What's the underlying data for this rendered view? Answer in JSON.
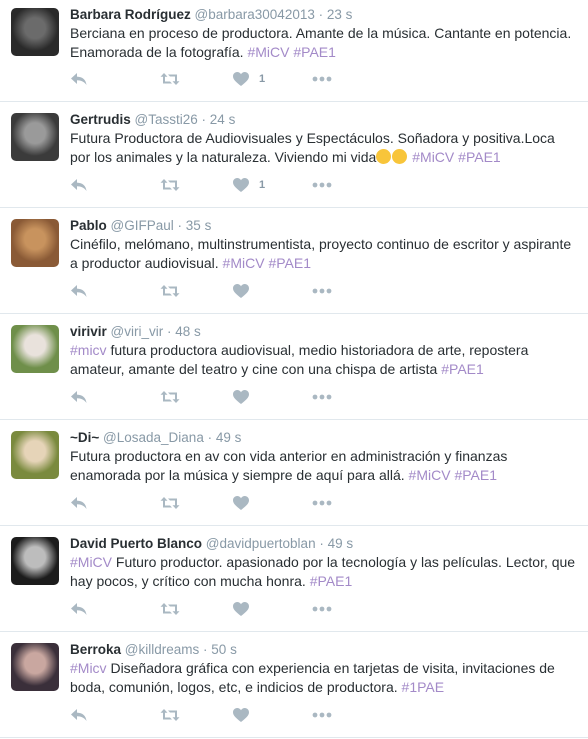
{
  "tweets": [
    {
      "name": "Barbara Rodríguez",
      "handle": "@barbara30042013",
      "time": "23 s",
      "text": "Berciana en proceso de productora. Amante de la música. Cantante en potencia. Enamorada de la fotografía.",
      "tags": [
        "#MiCV",
        "#PAE1"
      ],
      "like_count": "1",
      "avatar": {
        "bg": "#2a2a2a",
        "fg": "#6b6b6b"
      }
    },
    {
      "name": "Gertrudis",
      "handle": "@Tassti26",
      "time": "24 s",
      "text": "Futura Productora de Audiovisuales y Espectáculos. Soñadora y positiva.Loca por los animales y la naturaleza. Viviendo mi vida",
      "tags": [
        "#MiCV",
        "#PAE1"
      ],
      "like_count": "1",
      "avatar": {
        "bg": "#3b3b3b",
        "fg": "#9a9a9a"
      }
    },
    {
      "name": "Pablo",
      "handle": "@GIFPaul",
      "time": "35 s",
      "text": "Cinéfilo, melómano, multinstrumentista, proyecto continuo de escritor y aspirante a productor audiovisual.",
      "tags": [
        "#MiCV",
        "#PAE1"
      ],
      "like_count": "",
      "avatar": {
        "bg": "#8a5a36",
        "fg": "#c8935e"
      }
    },
    {
      "name": "virivir",
      "handle": "@viri_vir",
      "time": "48 s",
      "lead_tag": "#micv",
      "text": "futura productora audiovisual, medio historiadora de arte, repostera amateur, amante del teatro y cine con una chispa de artista",
      "tags": [
        "#PAE1"
      ],
      "like_count": "",
      "avatar": {
        "bg": "#6f8f4a",
        "fg": "#e9e2dc"
      }
    },
    {
      "name": "~Di~",
      "handle": "@Losada_Diana",
      "time": "49 s",
      "text": "Futura productora en av con vida anterior en administración y finanzas enamorada por la música y siempre de aquí para allá.",
      "tags": [
        "#MiCV",
        "#PAE1"
      ],
      "like_count": "",
      "avatar": {
        "bg": "#7a8a3e",
        "fg": "#e6d4b8"
      }
    },
    {
      "name": "David Puerto Blanco",
      "handle": "@davidpuertoblan",
      "time": "49 s",
      "lead_tag": "#MiCV",
      "text": "Futuro productor. apasionado por la tecnología y las películas. Lector, que hay pocos, y crítico con mucha honra.",
      "tags": [
        "#PAE1"
      ],
      "like_count": "",
      "avatar": {
        "bg": "#1c1c1c",
        "fg": "#bdbdbd"
      }
    },
    {
      "name": "Berroka",
      "handle": "@killdreams",
      "time": "50 s",
      "lead_tag": "#Micv",
      "text": "Diseñadora gráfica con experiencia en tarjetas de visita, invitaciones de boda, comunión, logos, etc, e indicios de productora.",
      "tags": [
        "#1PAE"
      ],
      "like_count": "",
      "avatar": {
        "bg": "#3a2f3a",
        "fg": "#c9a7a0"
      }
    }
  ],
  "separator": "·",
  "colors": {
    "hashtag": "#a38ac8",
    "muted": "#8899a6",
    "icon": "#aab8c2"
  }
}
